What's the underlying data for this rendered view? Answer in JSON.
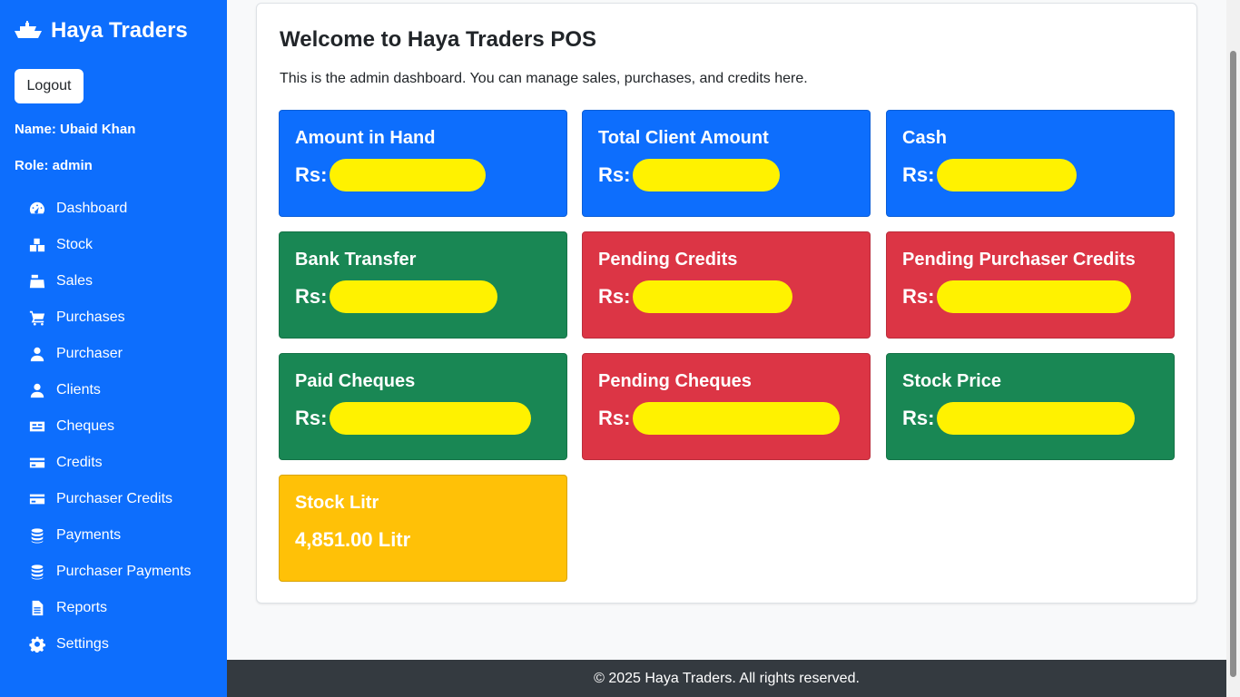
{
  "sidebar": {
    "brand": "Haya Traders",
    "logout_label": "Logout",
    "name_line": "Name: Ubaid Khan",
    "role_line": "Role: admin",
    "nav": [
      {
        "label": "Dashboard",
        "icon": "gauge-icon"
      },
      {
        "label": "Stock",
        "icon": "boxes-icon"
      },
      {
        "label": "Sales",
        "icon": "cash-register-icon"
      },
      {
        "label": "Purchases",
        "icon": "cart-icon"
      },
      {
        "label": "Purchaser",
        "icon": "user-icon"
      },
      {
        "label": "Clients",
        "icon": "user-icon"
      },
      {
        "label": "Cheques",
        "icon": "id-card-icon"
      },
      {
        "label": "Credits",
        "icon": "credit-card-icon"
      },
      {
        "label": "Purchaser Credits",
        "icon": "credit-card-icon"
      },
      {
        "label": "Payments",
        "icon": "coins-icon"
      },
      {
        "label": "Purchaser Payments",
        "icon": "coins-icon"
      },
      {
        "label": "Reports",
        "icon": "file-icon"
      },
      {
        "label": "Settings",
        "icon": "gear-icon"
      }
    ]
  },
  "main": {
    "title": "Welcome to Haya Traders POS",
    "description": "This is the admin dashboard. You can manage sales, purchases, and credits here.",
    "tiles": [
      {
        "title": "Amount in Hand",
        "prefix": "Rs:",
        "color": "#0d6efd"
      },
      {
        "title": "Total Client Amount",
        "prefix": "Rs:",
        "color": "#0d6efd"
      },
      {
        "title": "Cash",
        "prefix": "Rs:",
        "color": "#0d6efd"
      },
      {
        "title": "Bank Transfer",
        "prefix": "Rs:",
        "color": "#198754"
      },
      {
        "title": "Pending Credits",
        "prefix": "Rs:",
        "color": "#dc3545"
      },
      {
        "title": "Pending Purchaser Credits",
        "prefix": "Rs:",
        "color": "#dc3545"
      },
      {
        "title": "Paid Cheques",
        "prefix": "Rs:",
        "color": "#198754"
      },
      {
        "title": "Pending Cheques",
        "prefix": "Rs:",
        "color": "#dc3545"
      },
      {
        "title": "Stock Price",
        "prefix": "Rs:",
        "color": "#198754"
      },
      {
        "title": "Stock Litr",
        "value": "4,851.00 Litr",
        "color": "#ffc107"
      }
    ]
  },
  "footer": {
    "text": "© 2025 Haya Traders. All rights reserved."
  },
  "colors": {
    "sidebar": "#0d6efd",
    "footer": "#343a40",
    "redaction": "#fff200"
  }
}
